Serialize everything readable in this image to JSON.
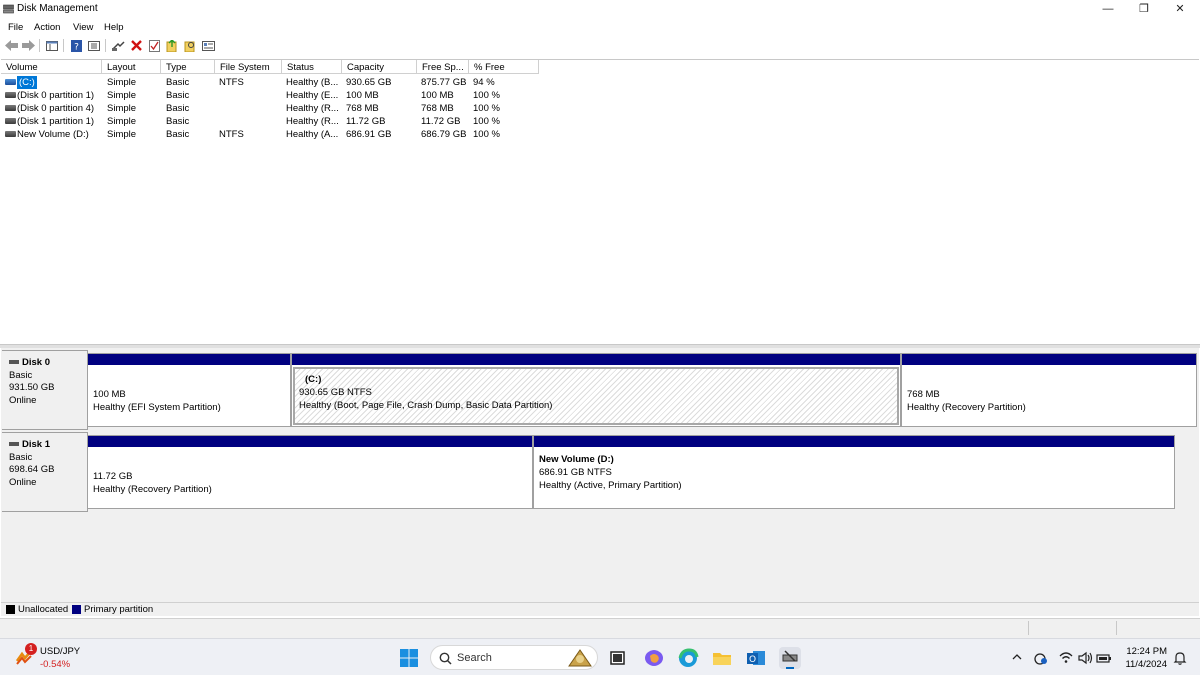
{
  "window": {
    "title": "Disk Management",
    "minimize_glyph": "—",
    "restore_glyph": "❐",
    "close_glyph": "✕"
  },
  "menu": [
    "File",
    "Action",
    "View",
    "Help"
  ],
  "toolbar": {
    "icons": [
      "back-icon",
      "forward-icon",
      "console-tree-icon",
      "help-icon",
      "properties-icon",
      "connect-icon",
      "delete-icon",
      "check-icon",
      "refresh-icon",
      "rescan-icon",
      "settings-icon"
    ]
  },
  "volume_list": {
    "columns": [
      "Volume",
      "Layout",
      "Type",
      "File System",
      "Status",
      "Capacity",
      "Free Sp...",
      "% Free"
    ],
    "rows": [
      {
        "volume": "(C:)",
        "layout": "Simple",
        "type": "Basic",
        "fs": "NTFS",
        "status": "Healthy (B...",
        "capacity": "930.65 GB",
        "free": "875.77 GB",
        "pct": "94 %"
      },
      {
        "volume": "(Disk 0 partition 1)",
        "layout": "Simple",
        "type": "Basic",
        "fs": "",
        "status": "Healthy (E...",
        "capacity": "100 MB",
        "free": "100 MB",
        "pct": "100 %"
      },
      {
        "volume": "(Disk 0 partition 4)",
        "layout": "Simple",
        "type": "Basic",
        "fs": "",
        "status": "Healthy (R...",
        "capacity": "768 MB",
        "free": "768 MB",
        "pct": "100 %"
      },
      {
        "volume": "(Disk 1 partition 1)",
        "layout": "Simple",
        "type": "Basic",
        "fs": "",
        "status": "Healthy (R...",
        "capacity": "11.72 GB",
        "free": "11.72 GB",
        "pct": "100 %"
      },
      {
        "volume": "New Volume (D:)",
        "layout": "Simple",
        "type": "Basic",
        "fs": "NTFS",
        "status": "Healthy (A...",
        "capacity": "686.91 GB",
        "free": "686.79 GB",
        "pct": "100 %"
      }
    ]
  },
  "disks": [
    {
      "name": "Disk 0",
      "type": "Basic",
      "size": "931.50 GB",
      "state": "Online",
      "partitions": [
        {
          "name": "",
          "size": "100 MB",
          "status": "Healthy (EFI System Partition)"
        },
        {
          "name": "(C:)",
          "size": "930.65 GB NTFS",
          "status": "Healthy (Boot, Page File, Crash Dump, Basic Data Partition)"
        },
        {
          "name": "",
          "size": "768 MB",
          "status": "Healthy (Recovery Partition)"
        }
      ]
    },
    {
      "name": "Disk 1",
      "type": "Basic",
      "size": "698.64 GB",
      "state": "Online",
      "partitions": [
        {
          "name": "",
          "size": "11.72 GB",
          "status": "Healthy (Recovery Partition)"
        },
        {
          "name": "New Volume  (D:)",
          "size": "686.91 GB NTFS",
          "status": "Healthy (Active, Primary Partition)"
        }
      ]
    }
  ],
  "legend": {
    "unallocated": "Unallocated",
    "primary": "Primary partition",
    "unallocated_color": "#000000",
    "primary_color": "#000080"
  },
  "taskbar": {
    "widget_title": "USD/JPY",
    "widget_value": "-0.54%",
    "widget_badge": "1",
    "search_placeholder": "Search",
    "time": "12:24 PM",
    "date": "11/4/2024"
  }
}
